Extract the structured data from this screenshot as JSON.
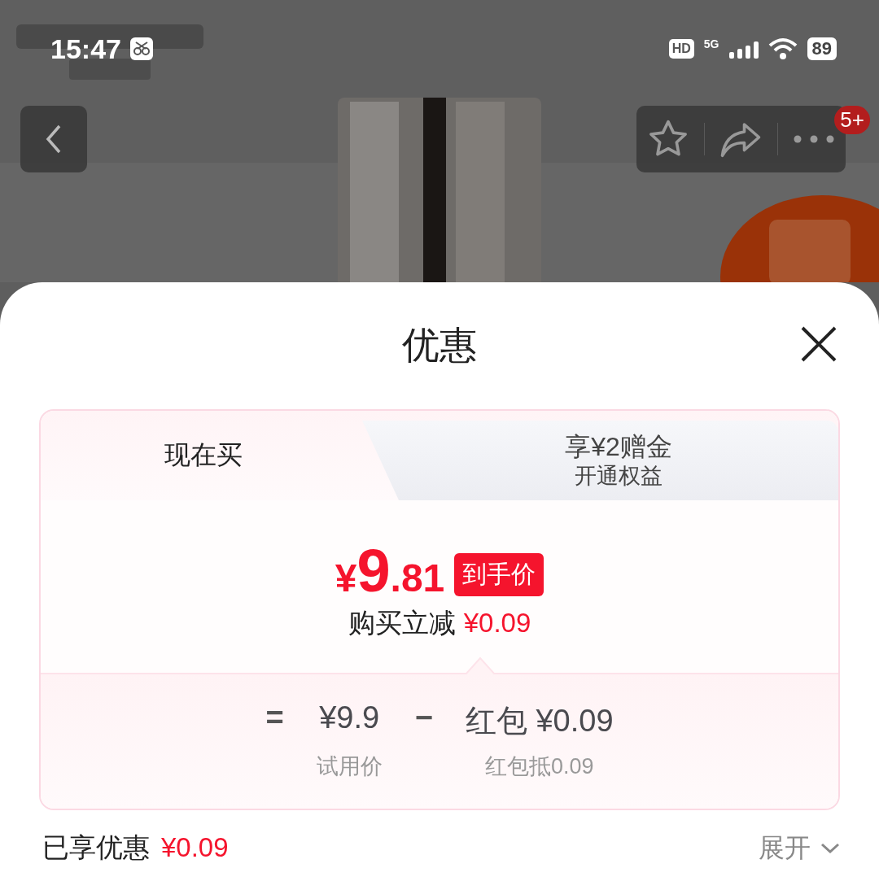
{
  "status_bar": {
    "time": "15:47",
    "hd": "HD",
    "network": "5G",
    "battery": "89"
  },
  "nav": {
    "badge": "5+"
  },
  "sheet": {
    "title": "优惠"
  },
  "tabs": [
    {
      "label": "现在买",
      "selected": true
    },
    {
      "label": "享¥2赠金",
      "sublabel": "开通权益",
      "selected": false
    }
  ],
  "price": {
    "currency": "¥",
    "integer": "9",
    "decimal": ".81",
    "tag": "到手价",
    "saving_label": "购买立减",
    "saving": "¥0.09"
  },
  "formula": {
    "equals": "=",
    "minus": "−",
    "terms": [
      {
        "value": "¥9.9",
        "caption": "试用价"
      },
      {
        "value": "红包 ¥0.09",
        "caption": "红包抵0.09"
      }
    ]
  },
  "summary": {
    "label": "已享优惠",
    "amount": "¥0.09",
    "toggle": "展开"
  }
}
